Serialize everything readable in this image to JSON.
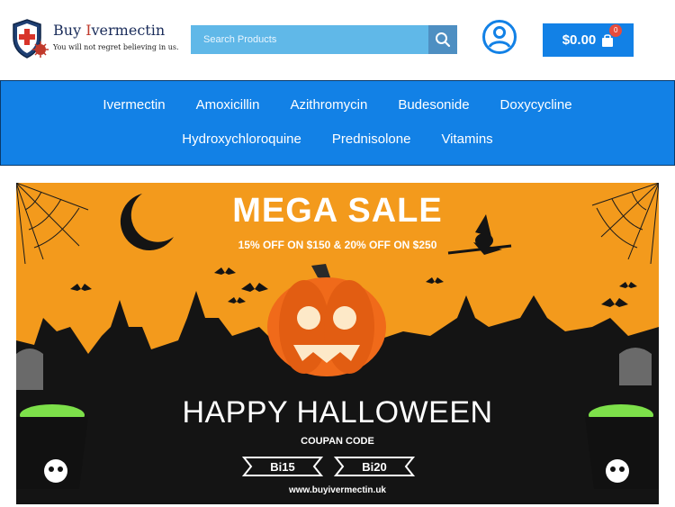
{
  "header": {
    "brand_prefix": "Buy ",
    "brand_i": "I",
    "brand_rest": "vermectin",
    "tagline": "You will not regret believing in us.",
    "search_placeholder": "Search Products",
    "cart_total": "$0.00",
    "cart_count": "0",
    "icons": [
      "shield-cross-logo",
      "virus-icon",
      "search-icon",
      "user-account-icon",
      "shopping-bag-icon"
    ]
  },
  "nav": {
    "row1": [
      "Ivermectin",
      "Amoxicillin",
      "Azithromycin",
      "Budesonide",
      "Doxycycline"
    ],
    "row2": [
      "Hydroxychloroquine",
      "Prednisolone",
      "Vitamins"
    ]
  },
  "banner": {
    "headline": "MEGA SALE",
    "offer": "15% OFF ON $150 & 20% OFF ON $250",
    "title": "HAPPY HALLOWEEN",
    "coupon_label": "COUPAN CODE",
    "coupons": [
      "Bi15",
      "Bi20"
    ],
    "website": "www.buyivermectin.uk",
    "colors": {
      "orange": "#f39a1c",
      "dark": "#141414",
      "pumpkin": "#f06a1a",
      "potion": "#7de04a"
    }
  },
  "colors": {
    "nav_blue": "#1281e6",
    "search_blue": "#60b8e8"
  }
}
